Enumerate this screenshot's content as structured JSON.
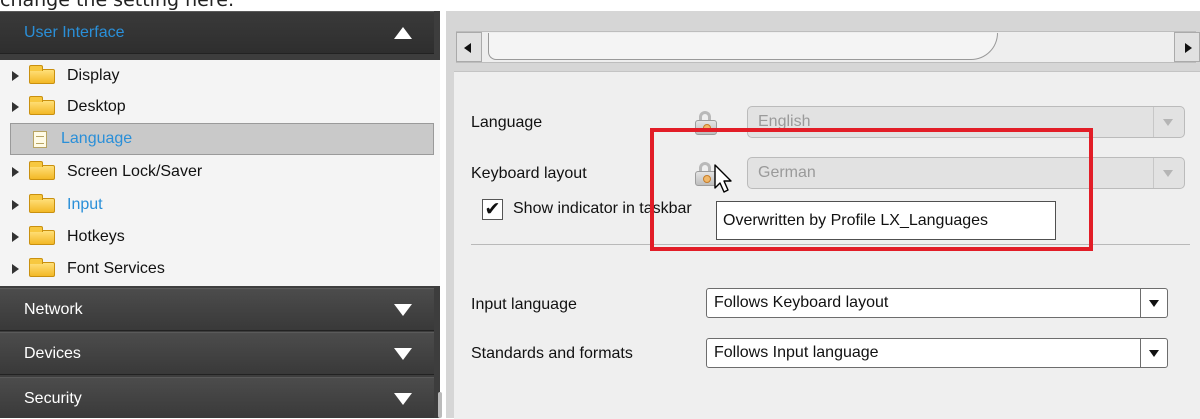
{
  "caption": "change the setting here:",
  "sidebar": {
    "categories": [
      {
        "label": "User Interface",
        "state": "open"
      },
      {
        "label": "Network",
        "state": "closed"
      },
      {
        "label": "Devices",
        "state": "closed"
      },
      {
        "label": "Security",
        "state": "closed"
      }
    ],
    "tree": [
      {
        "label": "Display",
        "icon": "folder-icon",
        "expandable": true
      },
      {
        "label": "Desktop",
        "icon": "folder-icon",
        "expandable": true
      },
      {
        "label": "Language",
        "icon": "file-icon",
        "expandable": false,
        "selected": true
      },
      {
        "label": "Screen Lock/Saver",
        "icon": "folder-icon",
        "expandable": true
      },
      {
        "label": "Input",
        "icon": "folder-icon",
        "expandable": true,
        "accent": true
      },
      {
        "label": "Hotkeys",
        "icon": "folder-icon",
        "expandable": true
      },
      {
        "label": "Font Services",
        "icon": "folder-icon",
        "expandable": true
      }
    ]
  },
  "settings": {
    "language": {
      "label": "Language",
      "value": "English",
      "locked": true
    },
    "keyboard_layout": {
      "label": "Keyboard layout",
      "value": "German",
      "locked": true
    },
    "show_indicator": {
      "label": "Show indicator in taskbar",
      "checked": true,
      "check_glyph": "✔"
    },
    "input_language": {
      "label": "Input language",
      "value": "Follows Keyboard layout"
    },
    "standards_formats": {
      "label": "Standards and formats",
      "value": "Follows Input language"
    }
  },
  "tooltip": {
    "text": "Overwritten by Profile LX_Languages"
  },
  "colors": {
    "accent_blue": "#2a8fd8",
    "highlight_red": "#e21d27",
    "sidebar_dark": "#3d3d3d"
  }
}
